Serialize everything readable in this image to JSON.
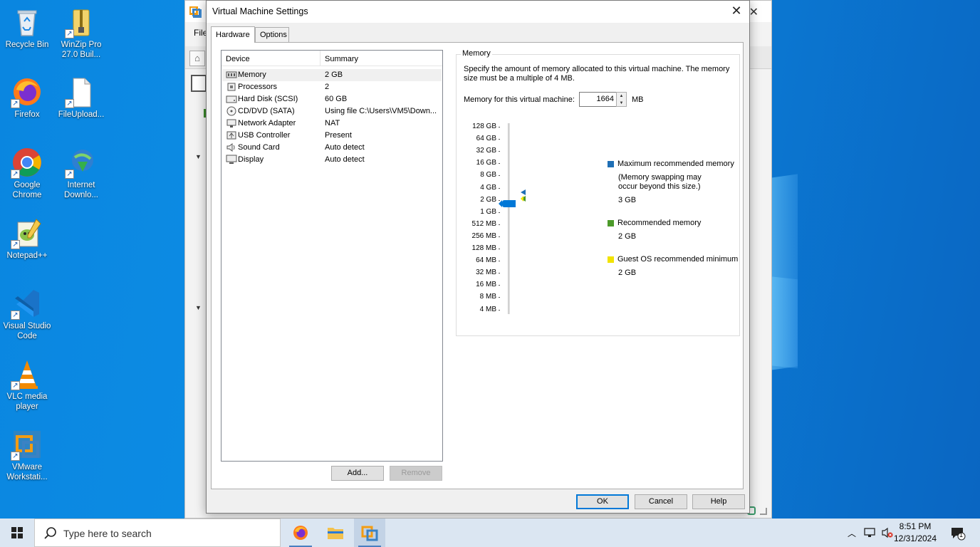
{
  "desktop": {
    "icons": [
      {
        "label": "Recycle Bin",
        "icon": "recycle-bin-icon"
      },
      {
        "label": "WinZip Pro 27.0 Buil...",
        "icon": "winzip-icon"
      },
      {
        "label": "Firefox",
        "icon": "firefox-icon"
      },
      {
        "label": "FileUpload...",
        "icon": "file-icon"
      },
      {
        "label": "Google Chrome",
        "icon": "chrome-icon"
      },
      {
        "label": "Internet Downlo...",
        "icon": "internet-download-manager-icon"
      },
      {
        "label": "Notepad++",
        "icon": "notepad-plus-plus-icon"
      },
      {
        "label": "Visual Studio Code",
        "icon": "vscode-icon"
      },
      {
        "label": "VLC media player",
        "icon": "vlc-icon"
      },
      {
        "label": "VMware Workstati...",
        "icon": "vmware-icon"
      }
    ]
  },
  "background_window": {
    "menu_label": "File",
    "close_glyph": "✕"
  },
  "dialog": {
    "title": "Virtual Machine Settings",
    "close_glyph": "✕",
    "tabs": [
      {
        "label": "Hardware",
        "active": true
      },
      {
        "label": "Options",
        "active": false
      }
    ],
    "device_list": {
      "columns": [
        "Device",
        "Summary"
      ],
      "rows": [
        {
          "device": "Memory",
          "summary": "2 GB",
          "icon": "memory-icon",
          "selected": true
        },
        {
          "device": "Processors",
          "summary": "2",
          "icon": "processor-icon",
          "selected": false
        },
        {
          "device": "Hard Disk (SCSI)",
          "summary": "60 GB",
          "icon": "hard-disk-icon",
          "selected": false
        },
        {
          "device": "CD/DVD (SATA)",
          "summary": "Using file C:\\Users\\VM5\\Down...",
          "icon": "cd-dvd-icon",
          "selected": false
        },
        {
          "device": "Network Adapter",
          "summary": "NAT",
          "icon": "network-adapter-icon",
          "selected": false
        },
        {
          "device": "USB Controller",
          "summary": "Present",
          "icon": "usb-icon",
          "selected": false
        },
        {
          "device": "Sound Card",
          "summary": "Auto detect",
          "icon": "speaker-icon",
          "selected": false
        },
        {
          "device": "Display",
          "summary": "Auto detect",
          "icon": "monitor-icon",
          "selected": false
        }
      ]
    },
    "add_button": "Add...",
    "remove_button": "Remove",
    "memory": {
      "group_label": "Memory",
      "description": "Specify the amount of memory allocated to this virtual machine. The memory size must be a multiple of 4 MB.",
      "field_label": "Memory for this virtual machine:",
      "value": "1664",
      "unit": "MB",
      "scale": [
        "128 GB",
        "64 GB",
        "32 GB",
        "16 GB",
        "8 GB",
        "4 GB",
        "2 GB",
        "1 GB",
        "512 MB",
        "256 MB",
        "128 MB",
        "64 MB",
        "32 MB",
        "16 MB",
        "8 MB",
        "4 MB"
      ],
      "legend": {
        "max": {
          "label": "Maximum recommended memory",
          "note": "(Memory swapping may occur beyond this size.)",
          "value": "3 GB",
          "color": "#1f6fb5"
        },
        "recommended": {
          "label": "Recommended memory",
          "value": "2 GB",
          "color": "#4c9a2a"
        },
        "guest_min": {
          "label": "Guest OS recommended minimum",
          "value": "2 GB",
          "color": "#f2e300"
        }
      }
    },
    "ok_button": "OK",
    "cancel_button": "Cancel",
    "help_button": "Help"
  },
  "taskbar": {
    "search_placeholder": "Type here to search",
    "apps": [
      "firefox-icon",
      "file-explorer-icon",
      "vmware-icon"
    ],
    "time": "8:51 PM",
    "date": "12/31/2024",
    "notification_count": "1"
  }
}
